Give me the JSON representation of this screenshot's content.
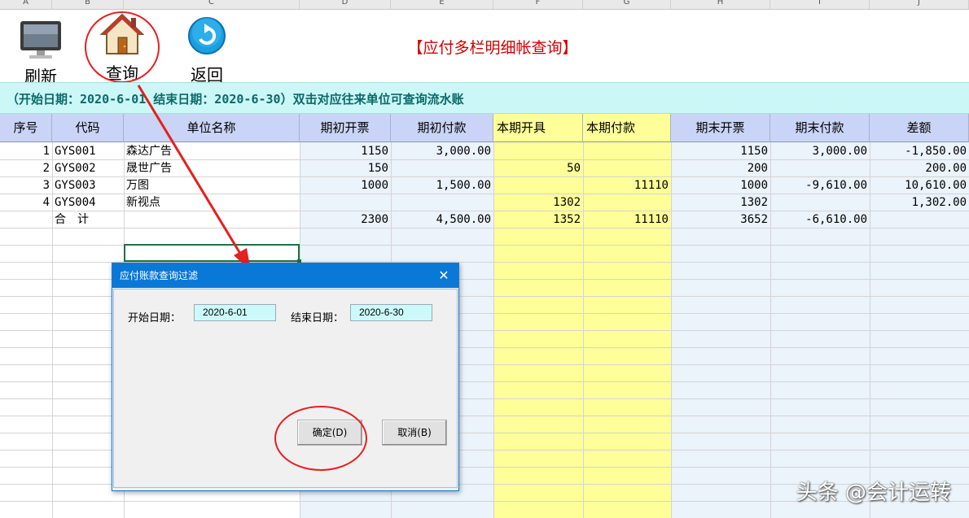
{
  "column_letters": [
    "A",
    "B",
    "C",
    "D",
    "E",
    "F",
    "G",
    "H",
    "I",
    "J"
  ],
  "toolbar": {
    "refresh_label": "刷新",
    "query_label": "查询",
    "back_label": "返回"
  },
  "title": "【应付多栏明细帐查询】",
  "info_bar": "（开始日期：2020-6-01 结束日期：2020-6-30）双击对应往来单位可查询流水账",
  "table": {
    "headers": [
      "序号",
      "代码",
      "单位名称",
      "期初开票",
      "期初付款",
      "本期开具",
      "本期付款",
      "期末开票",
      "期末付款",
      "差额"
    ],
    "rows": [
      [
        "1",
        "GYS001",
        "森达广告",
        "1150",
        "3,000.00",
        "",
        "",
        "1150",
        "3,000.00",
        "-1,850.00"
      ],
      [
        "2",
        "GYS002",
        "晟世广告",
        "150",
        "",
        "50",
        "",
        "200",
        "",
        "200.00"
      ],
      [
        "3",
        "GYS003",
        "万图",
        "1000",
        "1,500.00",
        "",
        "11110",
        "1000",
        "-9,610.00",
        "10,610.00"
      ],
      [
        "4",
        "GYS004",
        "新视点",
        "",
        "",
        "1302",
        "",
        "1302",
        "",
        "1,302.00"
      ]
    ],
    "total_row": [
      "",
      "合　计",
      "",
      "2300",
      "4,500.00",
      "1352",
      "11110",
      "3652",
      "-6,610.00",
      ""
    ]
  },
  "dialog": {
    "title": "应付账款查询过滤",
    "close_glyph": "✕",
    "start_label": "开始日期：",
    "start_value": "2020-6-01",
    "end_label": "结束日期：",
    "end_value": "2020-6-30",
    "ok_label": "确定(D)",
    "cancel_label": "取消(B)"
  },
  "watermark": "头条 @会计运转",
  "colors": {
    "title_red": "#d40000",
    "info_bg": "#ccf7f7",
    "header_bg": "#c9d4f6",
    "highlight_yellow": "#ffff99",
    "light_blue_col": "#ebf3fb",
    "dialog_title_bg": "#0a78d7",
    "annotation_red": "#e52020"
  }
}
